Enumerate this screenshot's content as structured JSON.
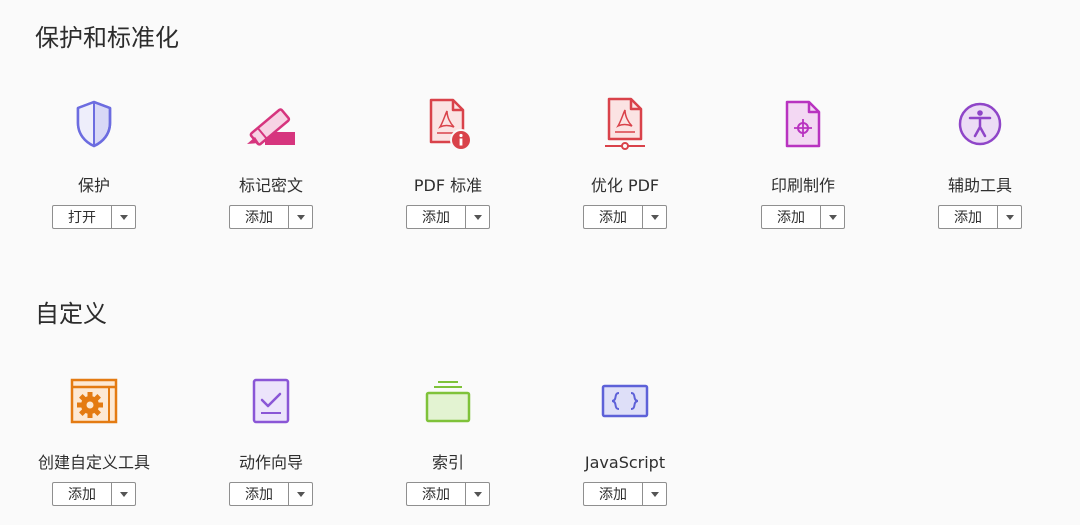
{
  "sections": [
    {
      "title": "保护和标准化",
      "tools": [
        {
          "label": "保护",
          "button": "打开",
          "icon": "shield-icon"
        },
        {
          "label": "标记密文",
          "button": "添加",
          "icon": "redact-marker-icon"
        },
        {
          "label": "PDF 标准",
          "button": "添加",
          "icon": "pdf-standards-icon"
        },
        {
          "label": "优化 PDF",
          "button": "添加",
          "icon": "optimize-pdf-icon"
        },
        {
          "label": "印刷制作",
          "button": "添加",
          "icon": "print-production-icon"
        },
        {
          "label": "辅助工具",
          "button": "添加",
          "icon": "accessibility-icon"
        }
      ]
    },
    {
      "title": "自定义",
      "tools": [
        {
          "label": "创建自定义工具",
          "button": "添加",
          "icon": "custom-tool-gear-icon"
        },
        {
          "label": "动作向导",
          "button": "添加",
          "icon": "action-wizard-icon"
        },
        {
          "label": "索引",
          "button": "添加",
          "icon": "index-icon"
        },
        {
          "label": "JavaScript",
          "button": "添加",
          "icon": "javascript-icon"
        }
      ]
    }
  ],
  "dropdown_glyph": "chevron-down-icon"
}
